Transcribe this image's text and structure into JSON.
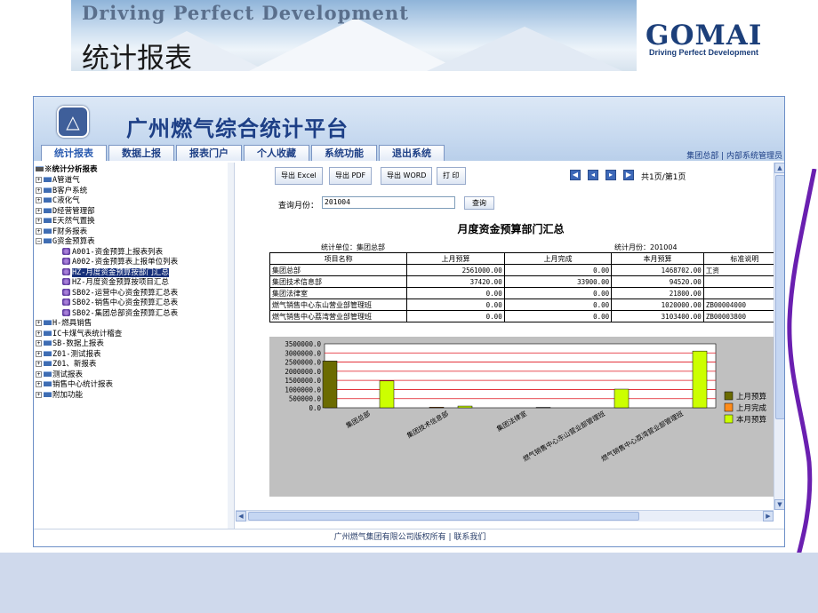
{
  "slide": {
    "banner_motto": "Driving Perfect Development",
    "title": "统计报表",
    "logo_word": "GOMAI",
    "logo_sub": "Driving Perfect Development"
  },
  "app": {
    "title": "广州燃气综合统计平台",
    "nav_tabs": [
      {
        "label": "统计报表",
        "active": true
      },
      {
        "label": "数据上报",
        "active": false
      },
      {
        "label": "报表门户",
        "active": false
      },
      {
        "label": "个人收藏",
        "active": false
      },
      {
        "label": "系统功能",
        "active": false
      },
      {
        "label": "退出系统",
        "active": false
      }
    ],
    "user_info": "集团总部 | 内部系统管理员",
    "footer": "广州燃气集团有限公司版权所有 | 联系我们"
  },
  "tree": {
    "root": "※统计分析报表",
    "items": [
      {
        "label": "A管道气",
        "type": "folder",
        "expanded": false
      },
      {
        "label": "B客户系统",
        "type": "folder",
        "expanded": false
      },
      {
        "label": "C液化气",
        "type": "folder",
        "expanded": false
      },
      {
        "label": "D经营管理部",
        "type": "folder",
        "expanded": false
      },
      {
        "label": "E天然气置换",
        "type": "folder",
        "expanded": false
      },
      {
        "label": "F财务报表",
        "type": "folder",
        "expanded": false
      },
      {
        "label": "G资金预算表",
        "type": "folder",
        "expanded": true
      },
      {
        "label": "A001-资金预算上报表列表",
        "type": "report",
        "selected": false
      },
      {
        "label": "A002-资金预算表上报单位列表",
        "type": "report",
        "selected": false
      },
      {
        "label": "HZ-月度资金预算按部门汇总",
        "type": "report",
        "selected": true
      },
      {
        "label": "HZ-月度资金预算按项目汇总",
        "type": "report",
        "selected": false
      },
      {
        "label": "SB02-运营中心资金预算汇总表",
        "type": "report",
        "selected": false
      },
      {
        "label": "SB02-销售中心资金预算汇总表",
        "type": "report",
        "selected": false
      },
      {
        "label": "SB02-集团总部资金预算汇总表",
        "type": "report",
        "selected": false
      },
      {
        "label": "H-燃具销售",
        "type": "folder",
        "expanded": false
      },
      {
        "label": "IC卡煤气表统计稽查",
        "type": "folder",
        "expanded": false
      },
      {
        "label": "SB-数据上报表",
        "type": "folder",
        "expanded": false
      },
      {
        "label": "Z01-测试报表",
        "type": "folder",
        "expanded": false
      },
      {
        "label": "Z01、新报表",
        "type": "folder",
        "expanded": false
      },
      {
        "label": "测试报表",
        "type": "folder",
        "expanded": false
      },
      {
        "label": "销售中心统计报表",
        "type": "folder",
        "expanded": false
      },
      {
        "label": "附加功能",
        "type": "folder",
        "expanded": false
      }
    ]
  },
  "toolbar": {
    "export_excel": "导出 Excel",
    "export_pdf": "导出 PDF",
    "export_word": "导出 WORD",
    "print": "打 印",
    "pager_text": "共1页/第1页"
  },
  "query": {
    "label": "查询月份：",
    "value": "201004",
    "button": "查询"
  },
  "report": {
    "title": "月度资金预算部门汇总",
    "stat_unit": "统计单位：集团总部",
    "stat_month": "统计月份：201004",
    "columns": [
      "项目名称",
      "上月预算",
      "上月完成",
      "本月预算",
      "标准说明"
    ],
    "rows": [
      [
        "集团总部",
        "2561000.00",
        "0.00",
        "1468702.00",
        "工资"
      ],
      [
        "集团技术信息部",
        "37420.00",
        "33900.00",
        "94520.00",
        ""
      ],
      [
        "集团法律室",
        "0.00",
        "0.00",
        "21800.00",
        ""
      ],
      [
        "燃气销售中心东山营业部管理班",
        "0.00",
        "0.00",
        "1020000.00",
        "ZB00004000"
      ],
      [
        "燃气销售中心荔湾营业部管理班",
        "0.00",
        "0.00",
        "3103400.00",
        "ZB00003800"
      ]
    ]
  },
  "chart_data": {
    "type": "bar",
    "categories": [
      "集团总部",
      "集团技术信息部",
      "集团法律室",
      "燃气销售中心东山营业部管理班",
      "燃气销售中心荔湾营业部管理班"
    ],
    "series": [
      {
        "name": "上月预算",
        "values": [
          2561000,
          0,
          0,
          0,
          0
        ],
        "color": "#6b6b00"
      },
      {
        "name": "上月完成",
        "values": [
          0,
          33900,
          0,
          0,
          0
        ],
        "color": "#ff8c1a"
      },
      {
        "name": "本月预算",
        "values": [
          1468702,
          94520,
          21800,
          1020000,
          3103400
        ],
        "color": "#ccff00"
      }
    ],
    "y_ticks": [
      "3500000.0",
      "3000000.0",
      "2500000.0",
      "2000000.0",
      "1500000.0",
      "1000000.0",
      "500000.0",
      "0.0"
    ],
    "ylim": [
      0,
      3500000
    ],
    "grid": true,
    "legend_position": "right",
    "plot_background": "#ffffff",
    "panel_background": "#c0c0c0",
    "grid_color": "#e0141e"
  }
}
